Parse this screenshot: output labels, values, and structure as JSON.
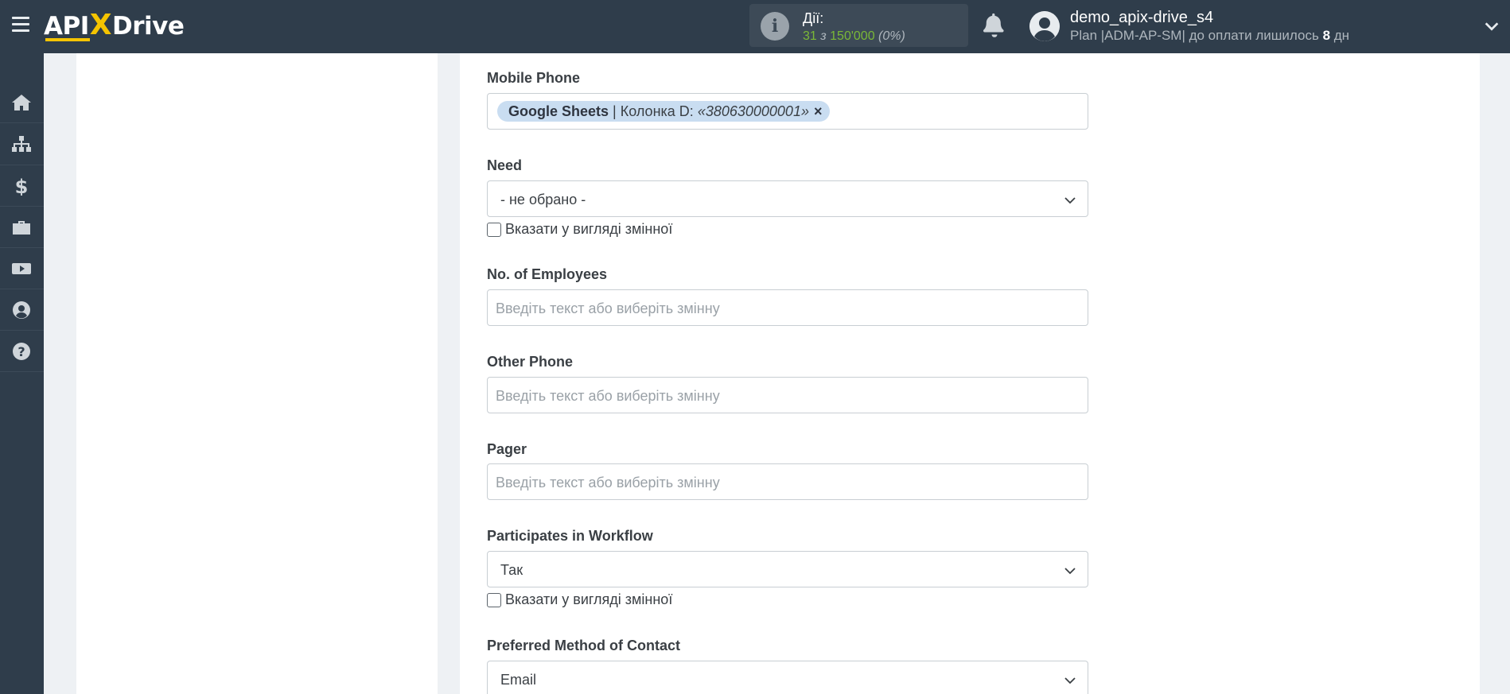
{
  "header": {
    "logo": {
      "part1": "API",
      "x": "X",
      "part2": "Drive"
    },
    "actions": {
      "title": "Дії:",
      "used": "31",
      "of_word": "з",
      "limit": "150'000",
      "percent": "(0%)"
    },
    "user": {
      "name": "demo_apix-drive_s4",
      "plan_prefix": "Plan |ADM-AP-SM| до оплати лишилось",
      "days": "8",
      "days_suffix": "дн"
    }
  },
  "sidebar": {
    "items": [
      {
        "icon": "home-icon"
      },
      {
        "icon": "sitemap-icon"
      },
      {
        "icon": "dollar-icon"
      },
      {
        "icon": "briefcase-icon"
      },
      {
        "icon": "youtube-icon"
      },
      {
        "icon": "user-icon"
      },
      {
        "icon": "question-icon"
      }
    ]
  },
  "form": {
    "mobile_phone": {
      "label": "Mobile Phone",
      "tag_source": "Google Sheets",
      "tag_separator": "|",
      "tag_column": "Колонка D:",
      "tag_value": "«380630000001»",
      "tag_remove": "×"
    },
    "need": {
      "label": "Need",
      "value": "- не обрано -",
      "checkbox_label": "Вказати у вигляді змінної"
    },
    "employees": {
      "label": "No. of Employees",
      "placeholder": "Введіть текст або виберіть змінну"
    },
    "other_phone": {
      "label": "Other Phone",
      "placeholder": "Введіть текст або виберіть змінну"
    },
    "pager": {
      "label": "Pager",
      "placeholder": "Введіть текст або виберіть змінну"
    },
    "workflow": {
      "label": "Participates in Workflow",
      "value": "Так",
      "checkbox_label": "Вказати у вигляді змінної"
    },
    "contact_method": {
      "label": "Preferred Method of Contact",
      "value": "Email"
    }
  },
  "colors": {
    "topbar": "#2f3d4b",
    "accent_yellow": "#f5c400",
    "green": "#7ab837",
    "tag_bg": "#c9ddf1"
  }
}
